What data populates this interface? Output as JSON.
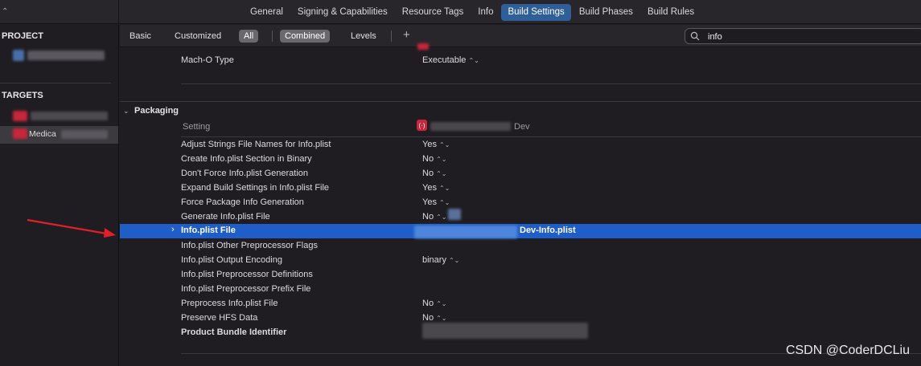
{
  "tabs": [
    "General",
    "Signing & Capabilities",
    "Resource Tags",
    "Info",
    "Build Settings",
    "Build Phases",
    "Build Rules"
  ],
  "active_tab": "Build Settings",
  "sidebar": {
    "project_header": "PROJECT",
    "targets_header": "TARGETS",
    "target_partial": "Medica"
  },
  "filter": {
    "basic": "Basic",
    "customized": "Customized",
    "all": "All",
    "combined": "Combined",
    "levels": "Levels",
    "plus": "+"
  },
  "search": {
    "value": "info"
  },
  "top_row": {
    "label": "Mach-O Type",
    "value": "Executable"
  },
  "section": {
    "title": "Packaging",
    "col_setting": "Setting",
    "col_target_suffix": "Dev"
  },
  "settings": [
    {
      "label": "Adjust Strings File Names for Info.plist",
      "value": "Yes"
    },
    {
      "label": "Create Info.plist Section in Binary",
      "value": "No"
    },
    {
      "label": "Don't Force Info.plist Generation",
      "value": "No"
    },
    {
      "label": "Expand Build Settings in Info.plist File",
      "value": "Yes"
    },
    {
      "label": "Force Package Info Generation",
      "value": "Yes"
    },
    {
      "label": "Generate Info.plist File",
      "value": "No"
    },
    {
      "label": "Info.plist File",
      "value": "Dev-Info.plist"
    },
    {
      "label": "Info.plist Other Preprocessor Flags",
      "value": ""
    },
    {
      "label": "Info.plist Output Encoding",
      "value": "binary"
    },
    {
      "label": "Info.plist Preprocessor Definitions",
      "value": ""
    },
    {
      "label": "Info.plist Preprocessor Prefix File",
      "value": ""
    },
    {
      "label": "Preprocess Info.plist File",
      "value": "No"
    },
    {
      "label": "Preserve HFS Data",
      "value": "No"
    },
    {
      "label": "Product Bundle Identifier",
      "value": ""
    }
  ],
  "watermark": "CSDN @CoderDCLiu",
  "colors": {
    "accent": "#2f5f99",
    "highlight_row": "#1f5ec8",
    "arrow": "#e0202a"
  }
}
